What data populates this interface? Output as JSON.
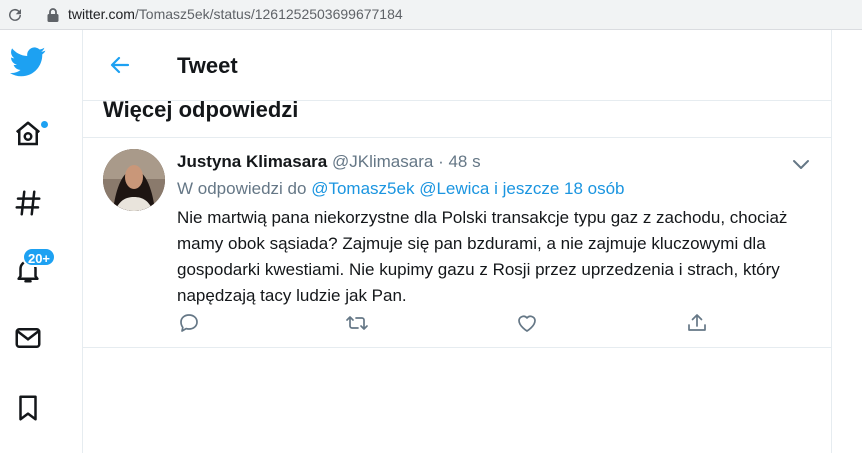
{
  "browser": {
    "url_host": "twitter.com",
    "url_path": "/Tomasz5ek/status/1261252503699677184"
  },
  "nav": {
    "items": [
      {
        "name": "twitter-logo-icon"
      },
      {
        "name": "home-icon",
        "has_dot": true
      },
      {
        "name": "explore-hashtag-icon"
      },
      {
        "name": "notifications-icon",
        "badge": "20+"
      },
      {
        "name": "messages-icon"
      },
      {
        "name": "bookmarks-icon"
      }
    ]
  },
  "header": {
    "title": "Tweet"
  },
  "section": {
    "title": "Więcej odpowiedzi"
  },
  "tweet": {
    "display_name": "Justyna Klimasara",
    "handle": "@JKlimasara",
    "separator": "·",
    "time": "48 s",
    "reply_prefix": "W odpowiedzi do",
    "reply_to_1": "@Tomasz5ek",
    "reply_to_2": "@Lewica",
    "reply_more": "i jeszcze 18 osób",
    "text": "Nie martwią pana niekorzystne dla Polski transakcje typu gaz z zachodu, chociaż mamy obok sąsiada? Zajmuje się pan bzdurami, a nie zajmuje kluczowymi dla gospodarki kwestiami. Nie kupimy gazu z Rosji przez uprzedzenia i strach, który napędzają tacy ludzie jak Pan."
  },
  "colors": {
    "accent": "#1da1f2",
    "link": "#1b95e0",
    "muted": "#657786",
    "border": "#e6ecf0"
  }
}
